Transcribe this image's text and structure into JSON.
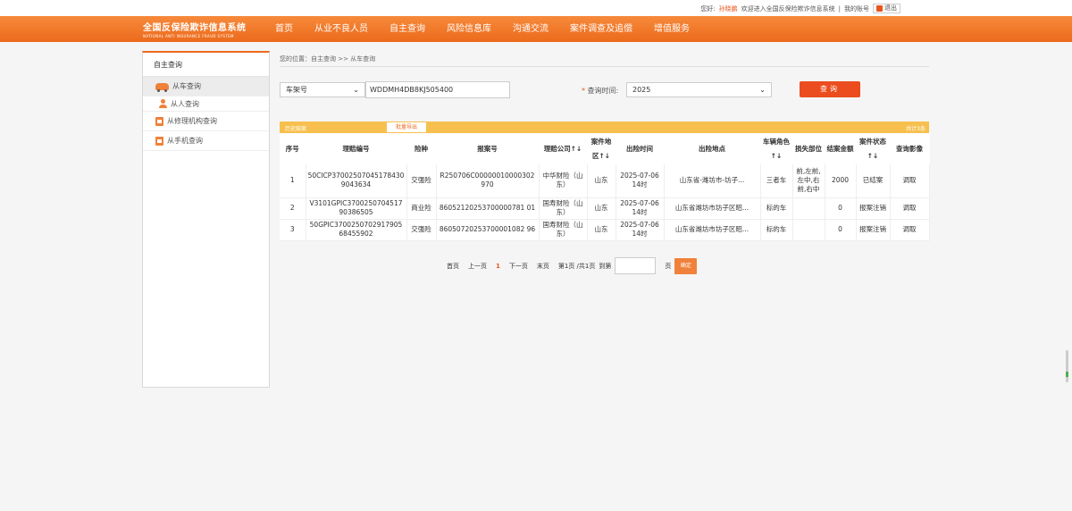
{
  "topbar": {
    "greeting": "您好:",
    "user": "孙晓鹏",
    "welcome": "欢迎进入全国反保险欺诈信息系统",
    "separator": "|",
    "my_account": "我的账号",
    "logout": "退出"
  },
  "brand": {
    "name": "全国反保险欺诈信息系统",
    "subtitle": "NATIONAL ANTI INSURANCE FRAUD SYSTEM"
  },
  "nav": {
    "items": [
      {
        "label": "首页"
      },
      {
        "label": "从业不良人员"
      },
      {
        "label": "自主查询"
      },
      {
        "label": "风险信息库"
      },
      {
        "label": "沟通交流"
      },
      {
        "label": "案件调查及追偿"
      },
      {
        "label": "增值服务"
      }
    ]
  },
  "sidebar": {
    "title": "自主查询",
    "items": [
      {
        "label": "从车查询",
        "icon": "car-icon"
      },
      {
        "label": "从人查询",
        "icon": "person-icon"
      },
      {
        "label": "从修理机构查询",
        "icon": "box-icon"
      },
      {
        "label": "从手机查询",
        "icon": "box-icon"
      }
    ]
  },
  "breadcrumb": "您的位置：自主查询 >> 从车查询",
  "search": {
    "type_value": "车架号",
    "vin_value": "WDDMH4DB8KJ505400",
    "time_label": "查询时间:",
    "time_required": "*",
    "time_value": "2025",
    "query_button": "查询"
  },
  "table": {
    "section_title": "历史赔案",
    "export_button": "批量导出",
    "total": "共计3条",
    "headers": [
      "序号",
      "理赔编号",
      "险种",
      "报案号",
      "理赔公司↑↓",
      "案件地区↑↓",
      "出险时间",
      "出险地点",
      "车辆角色↑↓",
      "损失部位",
      "结案金额",
      "案件状态↑↓",
      "查询影像"
    ],
    "rows": [
      [
        "1",
        "50CICP37002507045178430 9043634",
        "交强险",
        "R250706C00000010000302 970",
        "中华财险（山东）",
        "山东",
        "2025-07-06 14时",
        "山东省-潍坊市-坊子...",
        "三者车",
        "前,左前,左中,右前,右中",
        "2000",
        "已结案",
        "调取"
      ],
      [
        "2",
        "V3101GPIC3700250704517 90386505",
        "商业险",
        "86052120253700000781 01",
        "国寿财险（山东）",
        "山东",
        "2025-07-06 14时",
        "山东省潍坊市坊子区昭...",
        "标的车",
        "",
        "0",
        "报案注销",
        "调取"
      ],
      [
        "3",
        "50GPIC3700250702917905 68455902",
        "交强险",
        "86050720253700001082 96",
        "国寿财险（山东）",
        "山东",
        "2025-07-06 14时",
        "山东省潍坊市坊子区昭...",
        "标的车",
        "",
        "0",
        "报案注销",
        "调取"
      ]
    ]
  },
  "pager": {
    "first": "首页",
    "prev": "上一页",
    "current": "1",
    "next": "下一页",
    "last": "末页",
    "info": "第1页 /共1页",
    "goto": "到第",
    "page_unit": "页",
    "confirm": "确定"
  },
  "colors": {
    "accent": "#ec6a1b",
    "query_button": "#ec4d1e",
    "table_header": "#f7c04e"
  }
}
